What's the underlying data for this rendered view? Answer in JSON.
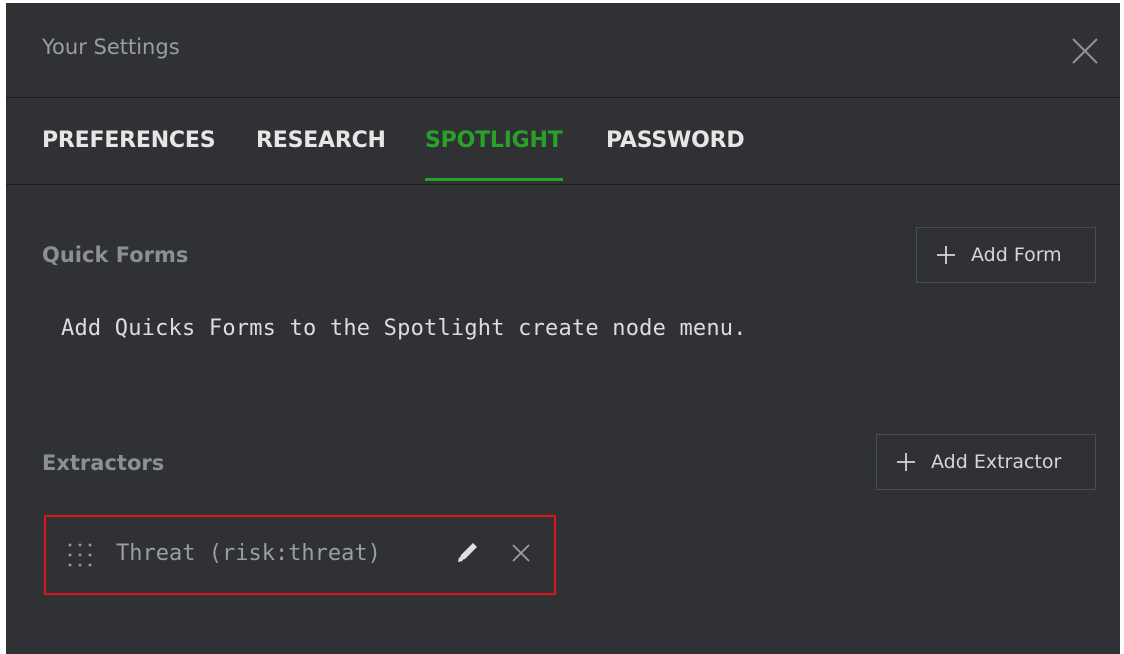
{
  "dialog": {
    "title": "Your Settings",
    "close_icon": "close-icon"
  },
  "tabs": [
    {
      "label": "PREFERENCES",
      "active": false
    },
    {
      "label": "RESEARCH",
      "active": false
    },
    {
      "label": "SPOTLIGHT",
      "active": true
    },
    {
      "label": "PASSWORD",
      "active": false
    }
  ],
  "quick_forms": {
    "title": "Quick Forms",
    "add_button_label": "Add Form",
    "description": "Add Quicks Forms to the Spotlight create node menu."
  },
  "extractors": {
    "title": "Extractors",
    "add_button_label": "Add Extractor",
    "items": [
      {
        "label": "Threat (risk:threat)"
      }
    ]
  },
  "colors": {
    "background": "#2f3134",
    "active_tab": "#29a129",
    "highlight_border": "#e3131b"
  }
}
